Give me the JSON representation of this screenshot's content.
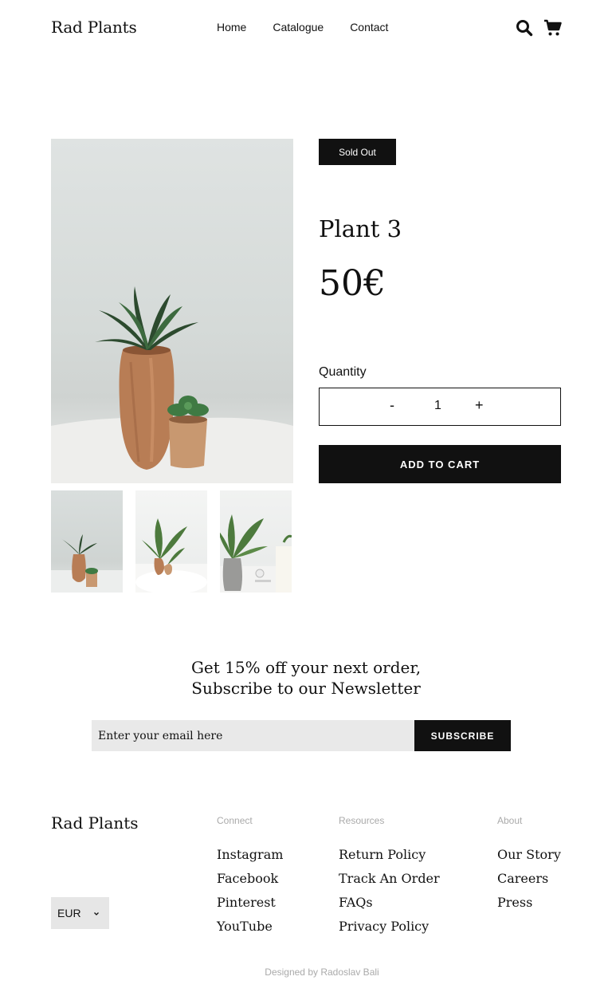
{
  "header": {
    "logo": "Rad Plants",
    "nav": [
      "Home",
      "Catalogue",
      "Contact"
    ],
    "icons": [
      "search-icon",
      "cart-icon"
    ]
  },
  "product": {
    "badge": "Sold Out",
    "title": "Plant 3",
    "price": "50€",
    "quantity_label": "Quantity",
    "quantity_minus": "-",
    "quantity_value": "1",
    "quantity_plus": "+",
    "add_to_cart": "ADD TO CART"
  },
  "newsletter": {
    "line1": "Get 15% off your next order,",
    "line2": "Subscribe to our Newsletter",
    "placeholder": "Enter your email here",
    "button": "SUBSCRIBE"
  },
  "footer": {
    "logo": "Rad Plants",
    "currency": "EUR",
    "columns": {
      "connect": {
        "heading": "Connect",
        "links": [
          "Instagram",
          "Facebook",
          "Pinterest",
          "YouTube"
        ]
      },
      "resources": {
        "heading": "Resources",
        "links": [
          "Return Policy",
          "Track An Order",
          "FAQs",
          "Privacy Policy"
        ]
      },
      "about": {
        "heading": "About",
        "links": [
          "Our Story",
          "Careers",
          "Press"
        ]
      }
    },
    "credit": "Designed by Radoslav Bali"
  },
  "colors": {
    "primary": "#111111",
    "input_bg": "#e9e9e9",
    "muted_text": "#aaaaaa"
  }
}
